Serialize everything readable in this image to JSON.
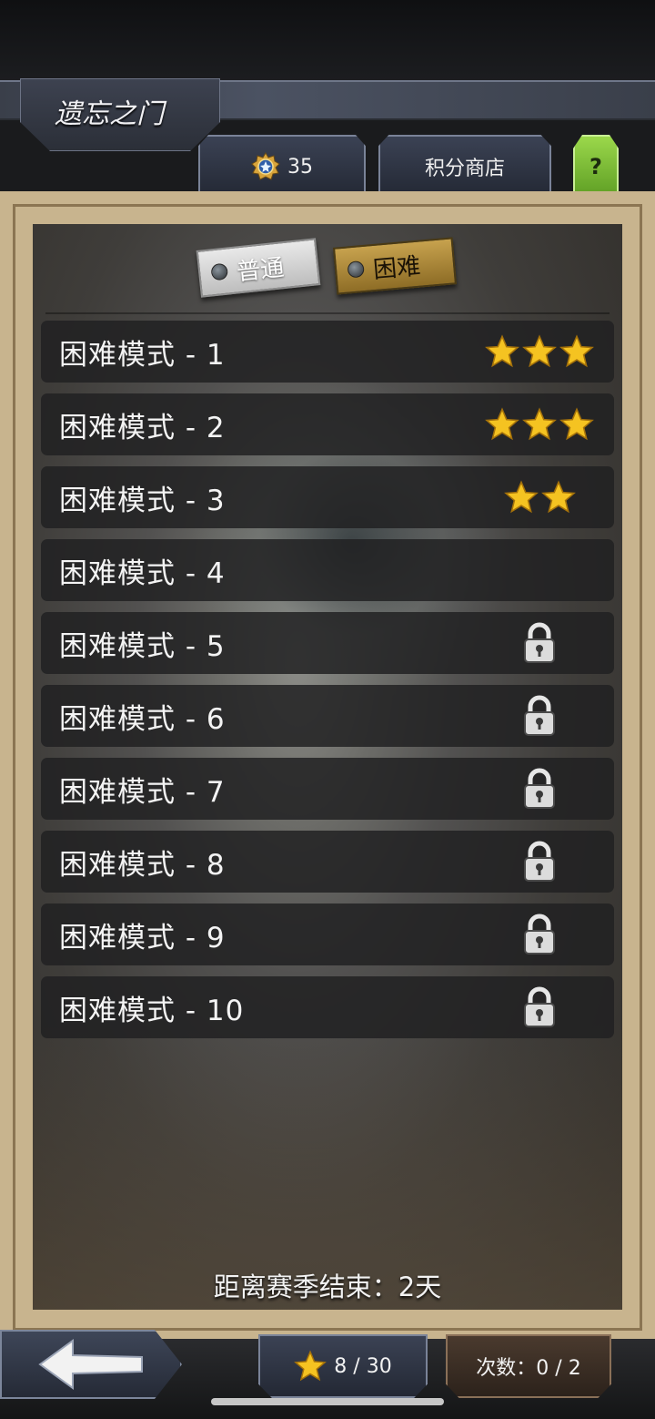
{
  "header": {
    "title": "遗忘之门",
    "points_value": "35",
    "shop_label": "积分商店",
    "help_label": "?"
  },
  "mode_toggle": {
    "normal_label": "普通",
    "hard_label": "困难",
    "selected": "困难"
  },
  "levels": [
    {
      "label": "困难模式 - 1",
      "stars": 3,
      "locked": false
    },
    {
      "label": "困难模式 - 2",
      "stars": 3,
      "locked": false
    },
    {
      "label": "困难模式 - 3",
      "stars": 2,
      "locked": false
    },
    {
      "label": "困难模式 - 4",
      "stars": 0,
      "locked": false
    },
    {
      "label": "困难模式 - 5",
      "stars": 0,
      "locked": true
    },
    {
      "label": "困难模式 - 6",
      "stars": 0,
      "locked": true
    },
    {
      "label": "困难模式 - 7",
      "stars": 0,
      "locked": true
    },
    {
      "label": "困难模式 - 8",
      "stars": 0,
      "locked": true
    },
    {
      "label": "困难模式 - 9",
      "stars": 0,
      "locked": true
    },
    {
      "label": "困难模式 - 10",
      "stars": 0,
      "locked": true
    }
  ],
  "season_text": "距离赛季结束：2天",
  "footer": {
    "stars_total": "8 / 30",
    "tries_text": "次数：0 / 2"
  },
  "colors": {
    "star": "#f5c321",
    "help_button": "#8ccc3f",
    "hard_chip": "#b08d3c"
  }
}
